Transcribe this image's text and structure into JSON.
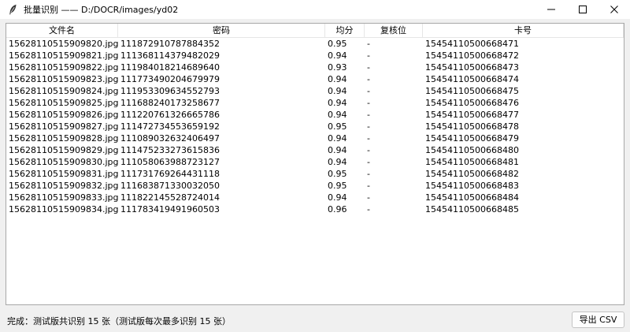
{
  "window": {
    "title": "批量识别 —— D:/DOCR/images/yd02",
    "app_icon": "feather-icon",
    "controls": [
      "minimize-icon",
      "maximize-icon",
      "close-icon"
    ]
  },
  "table": {
    "columns": [
      "文件名",
      "密码",
      "均分",
      "复核位",
      "卡号"
    ],
    "rows": [
      [
        "15628110515909820.jpg",
        "111872910787884352",
        "0.95",
        "-",
        "15454110500668471"
      ],
      [
        "15628110515909821.jpg",
        "111368114379482029",
        "0.94",
        "-",
        "15454110500668472"
      ],
      [
        "15628110515909822.jpg",
        "111984018214689640",
        "0.93",
        "-",
        "15454110500668473"
      ],
      [
        "15628110515909823.jpg",
        "111773490204679979",
        "0.94",
        "-",
        "15454110500668474"
      ],
      [
        "15628110515909824.jpg",
        "111953309634552793",
        "0.94",
        "-",
        "15454110500668475"
      ],
      [
        "15628110515909825.jpg",
        "111688240173258677",
        "0.94",
        "-",
        "15454110500668476"
      ],
      [
        "15628110515909826.jpg",
        "111220761326665786",
        "0.94",
        "-",
        "15454110500668477"
      ],
      [
        "15628110515909827.jpg",
        "111472734553659192",
        "0.95",
        "-",
        "15454110500668478"
      ],
      [
        "15628110515909828.jpg",
        "111089032632406497",
        "0.94",
        "-",
        "15454110500668479"
      ],
      [
        "15628110515909829.jpg",
        "111475233273615836",
        "0.94",
        "-",
        "15454110500668480"
      ],
      [
        "15628110515909830.jpg",
        "111058063988723127",
        "0.94",
        "-",
        "15454110500668481"
      ],
      [
        "15628110515909831.jpg",
        "111731769264431118",
        "0.95",
        "-",
        "15454110500668482"
      ],
      [
        "15628110515909832.jpg",
        "111683871330032050",
        "0.95",
        "-",
        "15454110500668483"
      ],
      [
        "15628110515909833.jpg",
        "111822145528724014",
        "0.94",
        "-",
        "15454110500668484"
      ],
      [
        "15628110515909834.jpg",
        "111783419491960503",
        "0.96",
        "-",
        "15454110500668485"
      ]
    ]
  },
  "status": {
    "text": "完成：测试版共识别 15 张（测试版每次最多识别 15 张）"
  },
  "export_button": {
    "label": "导出 CSV"
  }
}
